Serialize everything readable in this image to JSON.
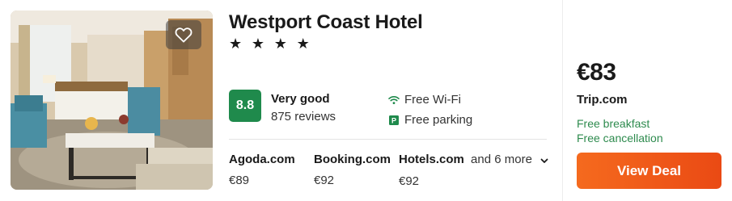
{
  "hotel": {
    "name": "Westport Coast Hotel",
    "stars": "★ ★ ★ ★",
    "rating_score": "8.8",
    "rating_label": "Very good",
    "review_count": "875 reviews",
    "amenities": [
      {
        "icon": "wifi-icon",
        "label": "Free Wi-Fi"
      },
      {
        "icon": "parking-icon",
        "label": "Free parking"
      }
    ]
  },
  "providers": [
    {
      "name": "Agoda.com",
      "price": "€89"
    },
    {
      "name": "Booking.com",
      "price": "€92"
    },
    {
      "name": "Hotels.com",
      "price": "€92"
    }
  ],
  "more_providers": "and 6 more",
  "deal": {
    "price": "€83",
    "site": "Trip.com",
    "perks": [
      "Free breakfast",
      "Free cancellation"
    ],
    "button_label": "View Deal"
  },
  "colors": {
    "rating_badge": "#1f8a4c",
    "perk_text": "#2e8b4e",
    "deal_button": "#f05a1a"
  }
}
